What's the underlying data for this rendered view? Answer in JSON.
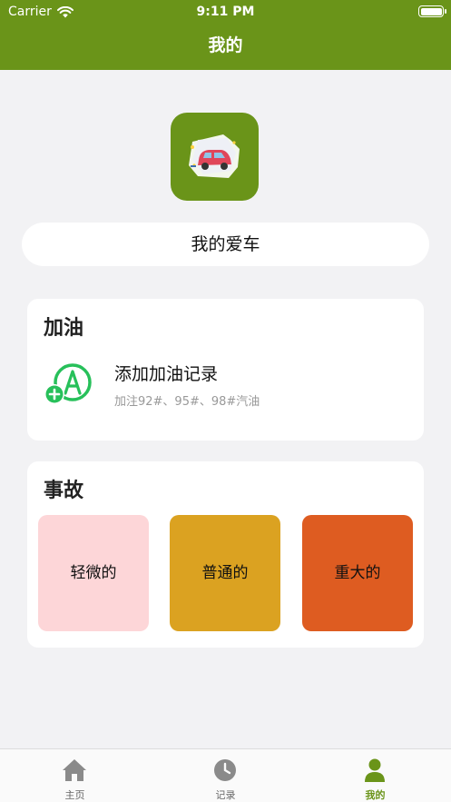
{
  "status_bar": {
    "carrier": "Carrier",
    "time": "9:11 PM"
  },
  "nav": {
    "title": "我的"
  },
  "profile": {
    "car_name": "我的爱车"
  },
  "fuel_section": {
    "title": "加油",
    "action_title": "添加加油记录",
    "action_subtitle": "加注92#、95#、98#汽油"
  },
  "accident_section": {
    "title": "事故",
    "levels": [
      {
        "label": "轻微的",
        "color": "#fdd6d8"
      },
      {
        "label": "普通的",
        "color": "#dba221"
      },
      {
        "label": "重大的",
        "color": "#de5c21"
      }
    ]
  },
  "tab_bar": {
    "tabs": [
      {
        "label": "主页",
        "icon": "home-icon",
        "active": false
      },
      {
        "label": "记录",
        "icon": "clock-icon",
        "active": false
      },
      {
        "label": "我的",
        "icon": "person-icon",
        "active": true
      }
    ]
  },
  "colors": {
    "brand": "#6a9419",
    "background": "#f2f2f4",
    "accent_green": "#27c05a"
  }
}
